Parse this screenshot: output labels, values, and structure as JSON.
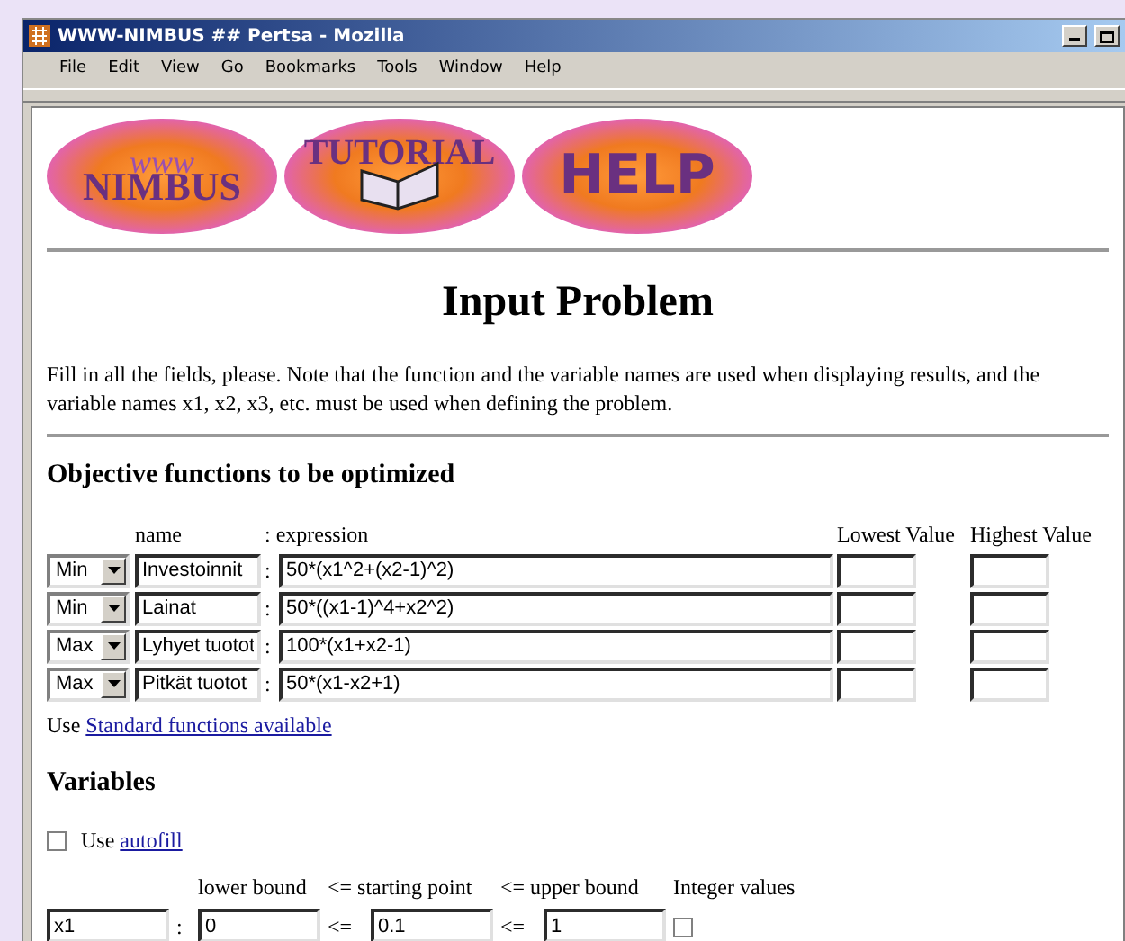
{
  "window": {
    "title": "WWW-NIMBUS ## Pertsa - Mozilla"
  },
  "menu": [
    "File",
    "Edit",
    "View",
    "Go",
    "Bookmarks",
    "Tools",
    "Window",
    "Help"
  ],
  "banner": [
    {
      "kind": "nimbus",
      "text": "NIMBUS",
      "script": "www"
    },
    {
      "kind": "tutorial",
      "text": "TUTORIAL"
    },
    {
      "kind": "help",
      "text": "HELP"
    }
  ],
  "heading": "Input Problem",
  "intro": "Fill in all the fields, please. Note that the function and the variable names are used when displaying results, and the variable names x1, x2, x3, etc. must be used when defining the problem.",
  "objectives": {
    "title": "Objective functions to be optimized",
    "columns": [
      "name",
      ": expression",
      "Lowest Value",
      "Highest Value"
    ],
    "rows": [
      {
        "direction": "Min",
        "name": "Investoinnit",
        "sep": ":",
        "expression": "50*(x1^2+(x2-1)^2)"
      },
      {
        "direction": "Min",
        "name": "Lainat",
        "sep": ":",
        "expression": "50*((x1-1)^4+x2^2)"
      },
      {
        "direction": "Max",
        "name": "Lyhyet tuotot",
        "sep": ":",
        "expression": "100*(x1+x2-1)"
      },
      {
        "direction": "Max",
        "name": "Pitkät tuotot",
        "sep": ":",
        "expression": "50*(x1-x2+1)"
      }
    ],
    "use_text": "Use",
    "link": "Standard functions available"
  },
  "variables": {
    "title": "Variables",
    "autofill": {
      "checked": false,
      "label": "Use",
      "link": "autofill"
    },
    "columns": [
      "lower bound",
      "<= starting point",
      "<= upper bound",
      "Integer values"
    ],
    "rows": [
      {
        "name": "x1",
        "sep": ":",
        "lower": "0",
        "le1": "<=",
        "start": "0.1",
        "le2": "<=",
        "upper": "1",
        "integer": false
      }
    ]
  }
}
